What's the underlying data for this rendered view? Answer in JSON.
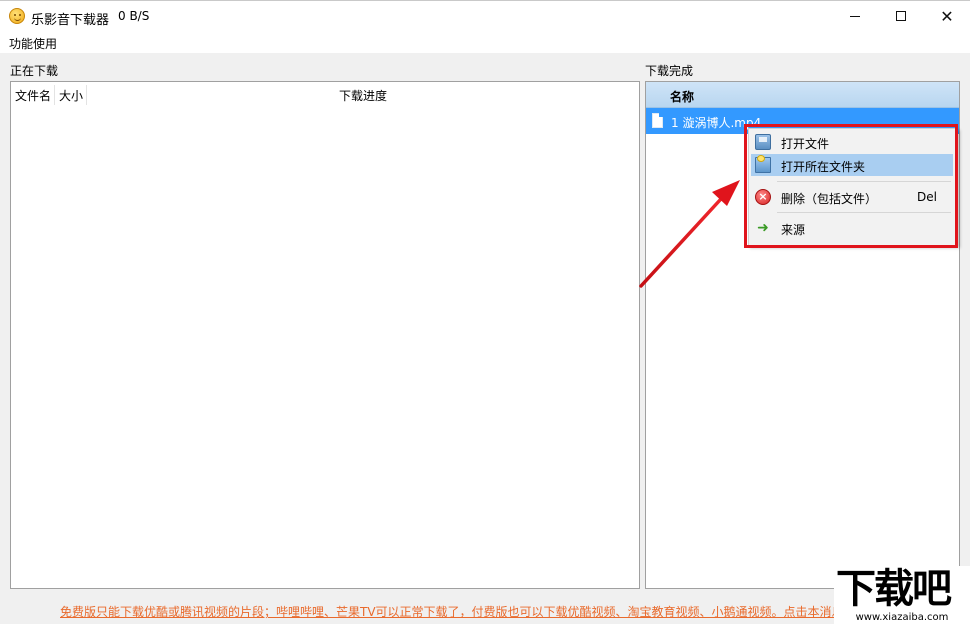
{
  "window": {
    "title": "乐影音下载器",
    "speed": "0 B/S"
  },
  "menubar": {
    "items": [
      {
        "label": "功能使用"
      }
    ]
  },
  "downloading": {
    "label": "正在下载",
    "columns": [
      "文件名",
      "大小",
      "下载进度"
    ]
  },
  "completed": {
    "label": "下载完成",
    "column": "名称",
    "rows": [
      {
        "name": "1 漩涡博人.mp4"
      }
    ]
  },
  "context_menu": {
    "items": [
      {
        "label": "打开文件",
        "icon": "open-file-icon"
      },
      {
        "label": "打开所在文件夹",
        "icon": "folder-icon",
        "highlighted": true
      },
      {
        "label": "删除（包括文件）",
        "shortcut": "Del",
        "icon": "delete-icon"
      },
      {
        "label": "来源",
        "icon": "source-icon"
      }
    ]
  },
  "footer": {
    "notice": "免费版只能下载优酷或腾讯视频的片段；哔哩哔哩、芒果TV可以正常下载了，付费版也可以下载优酷视频、淘宝教育视频、小鹅通视频。点击本消息"
  },
  "watermark": {
    "main": "下载吧",
    "sub": "www.xiazaiba.com"
  },
  "colors": {
    "selection": "#3399ff",
    "highlight_box": "#e0141c",
    "footer_link": "#e96a2c"
  }
}
